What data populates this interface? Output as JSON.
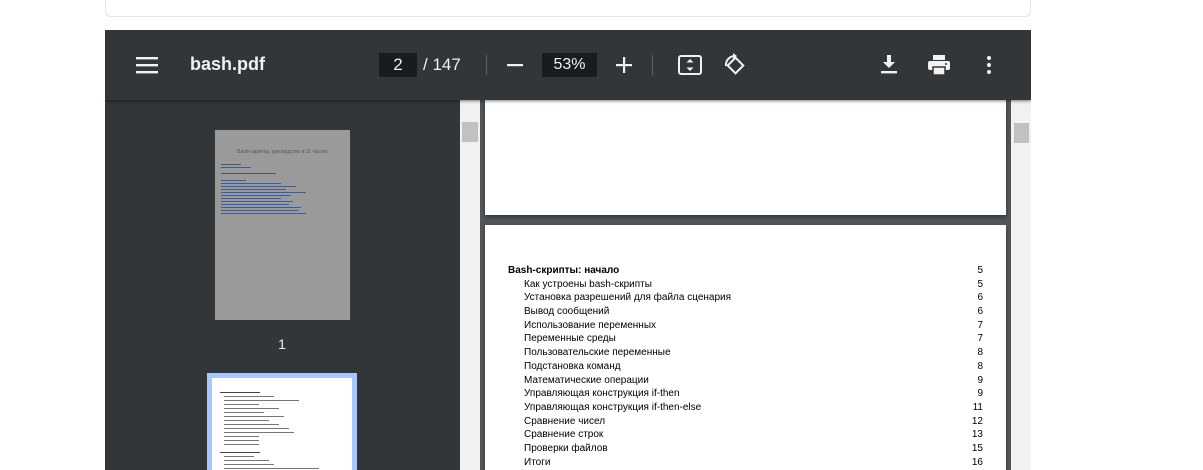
{
  "toolbar": {
    "title": "bash.pdf",
    "page_current": "2",
    "page_total": "/ 147",
    "zoom": "53%"
  },
  "sidebar": {
    "thumb1_title": "Bash-скрипты, руководство в 11 частях",
    "thumb1_label": "1"
  },
  "toc": [
    {
      "title": "Bash-скрипты: начало",
      "page": "5",
      "level": "head"
    },
    {
      "title": "Как устроены bash-скрипты",
      "page": "5",
      "level": "sub"
    },
    {
      "title": "Установка разрешений для файла сценария",
      "page": "6",
      "level": "sub"
    },
    {
      "title": "Вывод сообщений",
      "page": "6",
      "level": "sub"
    },
    {
      "title": "Использование переменных",
      "page": "7",
      "level": "sub"
    },
    {
      "title": "Переменные среды",
      "page": "7",
      "level": "sub"
    },
    {
      "title": "Пользовательские переменные",
      "page": "8",
      "level": "sub"
    },
    {
      "title": "Подстановка команд",
      "page": "8",
      "level": "sub"
    },
    {
      "title": "Математические операции",
      "page": "9",
      "level": "sub"
    },
    {
      "title": "Управляющая конструкция if-then",
      "page": "9",
      "level": "sub"
    },
    {
      "title": "Управляющая конструкция if-then-else",
      "page": "11",
      "level": "sub"
    },
    {
      "title": "Сравнение чисел",
      "page": "12",
      "level": "sub"
    },
    {
      "title": "Сравнение строк",
      "page": "13",
      "level": "sub"
    },
    {
      "title": "Проверки файлов",
      "page": "15",
      "level": "sub"
    },
    {
      "title": "Итоги",
      "page": "16",
      "level": "sub"
    }
  ]
}
